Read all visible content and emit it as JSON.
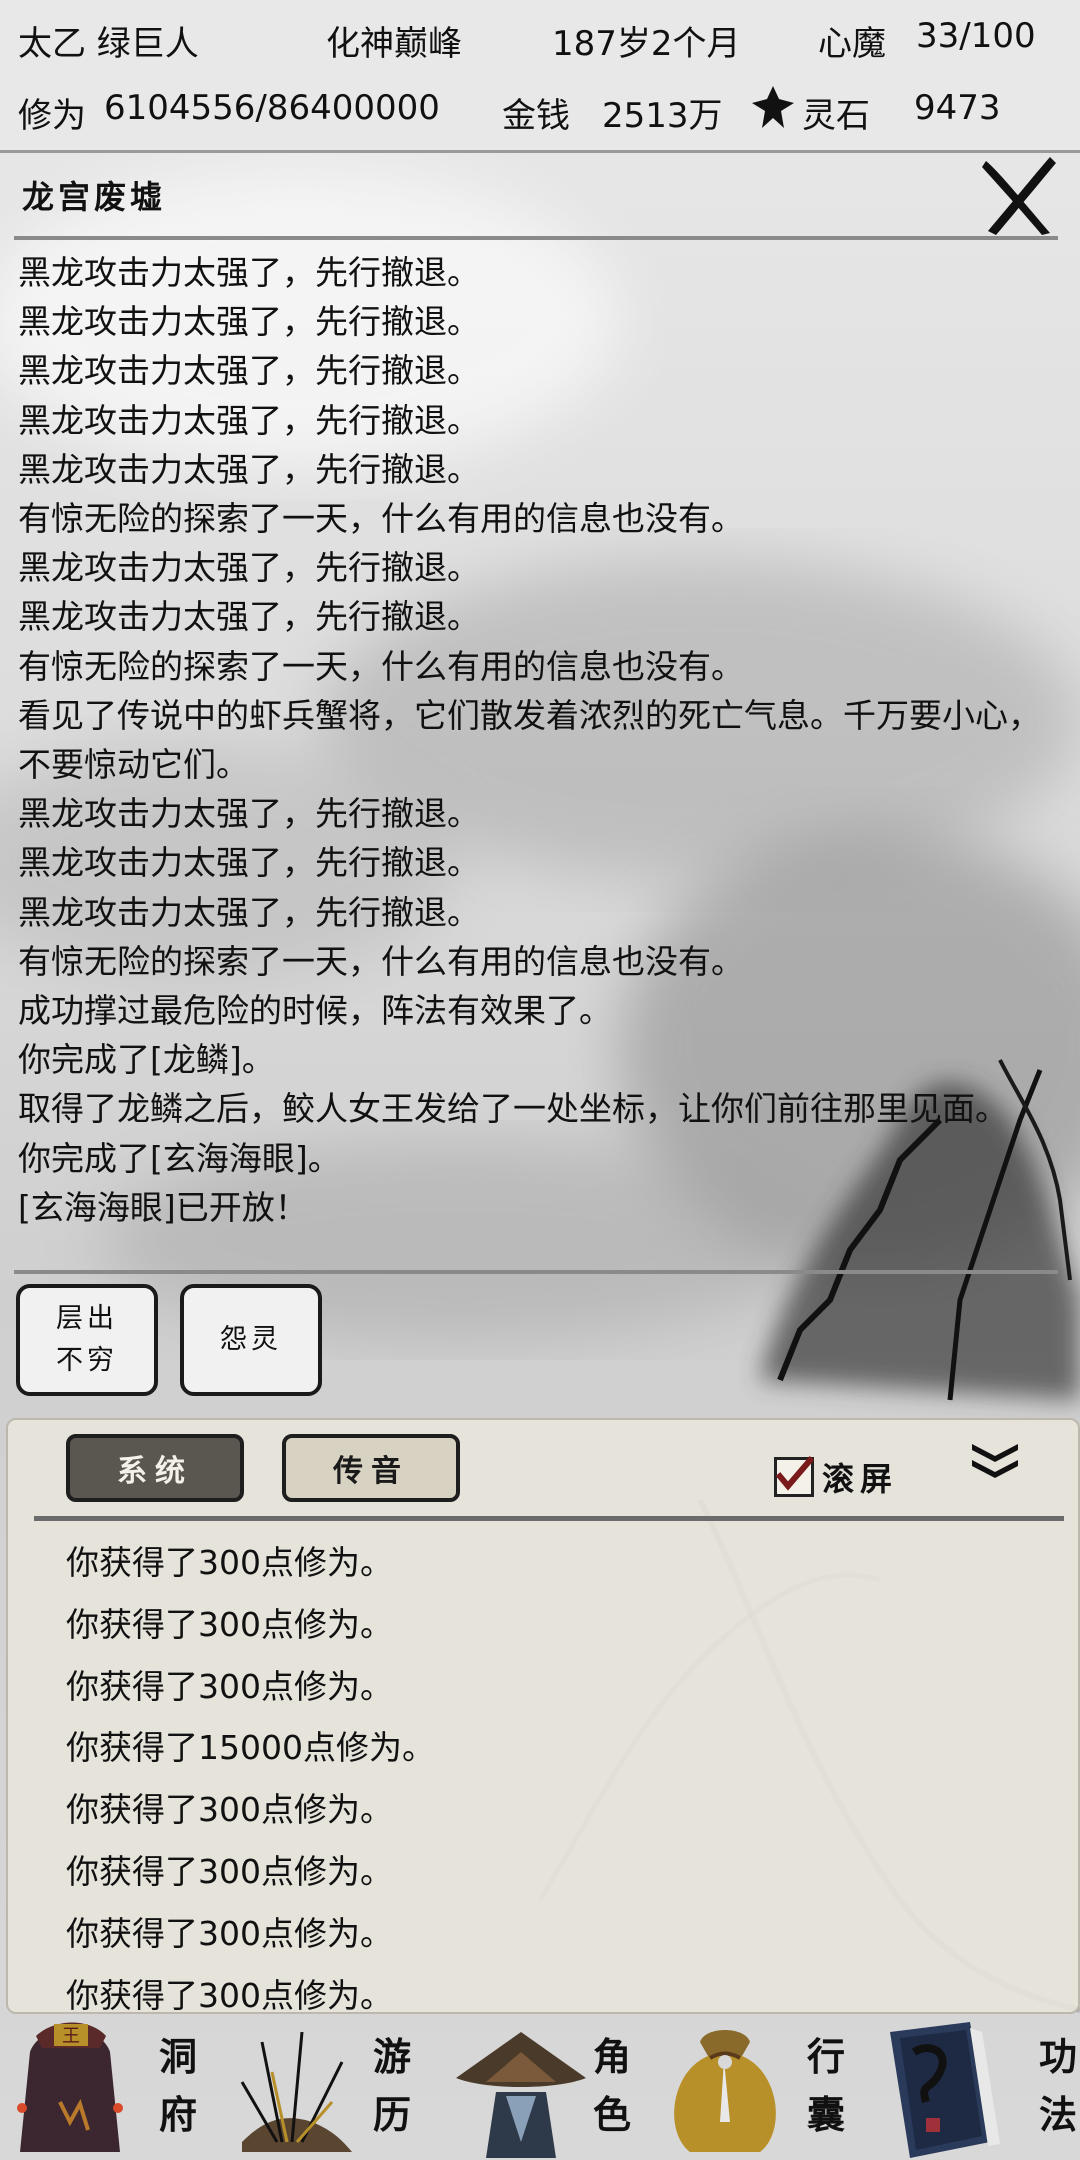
{
  "status": {
    "name": "太乙 绿巨人",
    "realm": "化神巅峰",
    "age": "187岁2个月",
    "heart_demon_label": "心魔",
    "heart_demon_value": "33/100",
    "cultivation_label": "修为",
    "cultivation_value": "6104556/86400000",
    "money_label": "金钱",
    "money_value": "2513万",
    "spirit_stone_label": "灵石",
    "spirit_stone_value": "9473"
  },
  "event_panel": {
    "title": "龙宫废墟",
    "log": [
      "黑龙攻击力太强了，先行撤退。",
      "黑龙攻击力太强了，先行撤退。",
      "黑龙攻击力太强了，先行撤退。",
      "黑龙攻击力太强了，先行撤退。",
      "黑龙攻击力太强了，先行撤退。",
      "有惊无险的探索了一天，什么有用的信息也没有。",
      "黑龙攻击力太强了，先行撤退。",
      "黑龙攻击力太强了，先行撤退。",
      "有惊无险的探索了一天，什么有用的信息也没有。",
      "看见了传说中的虾兵蟹将，它们散发着浓烈的死亡气息。千万要小心，不要惊动它们。",
      "黑龙攻击力太强了，先行撤退。",
      "黑龙攻击力太强了，先行撤退。",
      "黑龙攻击力太强了，先行撤退。",
      "有惊无险的探索了一天，什么有用的信息也没有。",
      "成功撑过最危险的时候，阵法有效果了。",
      "你完成了[龙鳞]。",
      "取得了龙鳞之后，鲛人女王发给了一处坐标，让你们前往那里见面。",
      "你完成了[玄海海眼]。",
      "[玄海海眼]已开放！"
    ],
    "buttons": {
      "endless_line1": "层出",
      "endless_line2": "不穷",
      "resentful_spirit": "怨灵"
    }
  },
  "chat": {
    "tab_system": "系统",
    "tab_voice": "传音",
    "scroll_label": "滚屏",
    "scroll_checked": true,
    "messages": [
      "你获得了300点修为。",
      "你获得了300点修为。",
      "你获得了300点修为。",
      "你获得了15000点修为。",
      "你获得了300点修为。",
      "你获得了300点修为。",
      "你获得了300点修为。",
      "你获得了300点修为。"
    ]
  },
  "nav": {
    "cave": [
      "洞",
      "府"
    ],
    "travel": [
      "游",
      "历"
    ],
    "character": [
      "角",
      "色"
    ],
    "bag": [
      "行",
      "囊"
    ],
    "skills": [
      "功",
      "法"
    ]
  },
  "colors": {
    "ink": "#111111",
    "tab_active": "#5a5751",
    "tab_inactive": "#d8d2c2",
    "panel_bg": "#e8e5dc"
  }
}
